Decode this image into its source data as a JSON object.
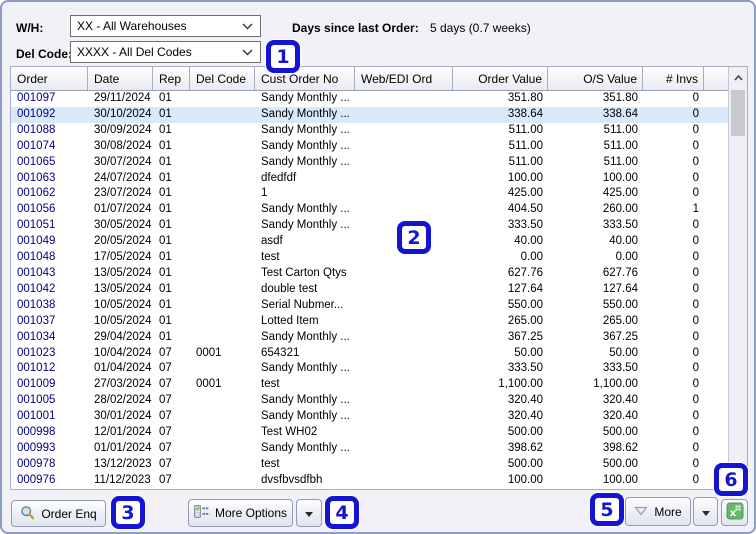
{
  "filters": {
    "wh_label": "W/H:",
    "wh_value": "XX - All Warehouses",
    "del_label": "Del Code:",
    "del_value": "XXXX - All Del Codes",
    "days_label": "Days since last Order:",
    "days_value": "5 days (0.7 weeks)"
  },
  "table": {
    "columns": [
      "Order",
      "Date",
      "Rep",
      "Del Code",
      "Cust Order No",
      "Web/EDI Ord",
      "Order Value",
      "O/S Value",
      "# Invs"
    ],
    "selected_order": "001092",
    "rows": [
      [
        "001097",
        "29/11/2024",
        "01",
        "",
        "Sandy Monthly ...",
        "",
        "351.80",
        "351.80",
        "0"
      ],
      [
        "001092",
        "30/10/2024",
        "01",
        "",
        "Sandy Monthly ...",
        "",
        "338.64",
        "338.64",
        "0"
      ],
      [
        "001088",
        "30/09/2024",
        "01",
        "",
        "Sandy Monthly ...",
        "",
        "511.00",
        "511.00",
        "0"
      ],
      [
        "001074",
        "30/08/2024",
        "01",
        "",
        "Sandy Monthly ...",
        "",
        "511.00",
        "511.00",
        "0"
      ],
      [
        "001065",
        "30/07/2024",
        "01",
        "",
        "Sandy Monthly ...",
        "",
        "511.00",
        "511.00",
        "0"
      ],
      [
        "001063",
        "24/07/2024",
        "01",
        "",
        "dfedfdf",
        "",
        "100.00",
        "100.00",
        "0"
      ],
      [
        "001062",
        "23/07/2024",
        "01",
        "",
        "1",
        "",
        "425.00",
        "425.00",
        "0"
      ],
      [
        "001056",
        "01/07/2024",
        "01",
        "",
        "Sandy Monthly ...",
        "",
        "404.50",
        "260.00",
        "1"
      ],
      [
        "001051",
        "30/05/2024",
        "01",
        "",
        "Sandy Monthly ...",
        "",
        "333.50",
        "333.50",
        "0"
      ],
      [
        "001049",
        "20/05/2024",
        "01",
        "",
        "asdf",
        "",
        "40.00",
        "40.00",
        "0"
      ],
      [
        "001048",
        "17/05/2024",
        "01",
        "",
        "test",
        "",
        "0.00",
        "0.00",
        "0"
      ],
      [
        "001043",
        "13/05/2024",
        "01",
        "",
        "Test Carton Qtys",
        "",
        "627.76",
        "627.76",
        "0"
      ],
      [
        "001042",
        "13/05/2024",
        "01",
        "",
        "double test",
        "",
        "127.64",
        "127.64",
        "0"
      ],
      [
        "001038",
        "10/05/2024",
        "01",
        "",
        "Serial Nubmer...",
        "",
        "550.00",
        "550.00",
        "0"
      ],
      [
        "001037",
        "10/05/2024",
        "01",
        "",
        "Lotted Item",
        "",
        "265.00",
        "265.00",
        "0"
      ],
      [
        "001034",
        "29/04/2024",
        "01",
        "",
        "Sandy Monthly ...",
        "",
        "367.25",
        "367.25",
        "0"
      ],
      [
        "001023",
        "10/04/2024",
        "07",
        "0001",
        "654321",
        "",
        "50.00",
        "50.00",
        "0"
      ],
      [
        "001012",
        "01/04/2024",
        "07",
        "",
        "Sandy Monthly ...",
        "",
        "333.50",
        "333.50",
        "0"
      ],
      [
        "001009",
        "27/03/2024",
        "07",
        "0001",
        "test",
        "",
        "1,100.00",
        "1,100.00",
        "0"
      ],
      [
        "001005",
        "28/02/2024",
        "07",
        "",
        "Sandy Monthly ...",
        "",
        "320.40",
        "320.40",
        "0"
      ],
      [
        "001001",
        "30/01/2024",
        "07",
        "",
        "Sandy Monthly ...",
        "",
        "320.40",
        "320.40",
        "0"
      ],
      [
        "000998",
        "12/01/2024",
        "07",
        "",
        "Test WH02",
        "",
        "500.00",
        "500.00",
        "0"
      ],
      [
        "000993",
        "01/01/2024",
        "07",
        "",
        "Sandy Monthly ...",
        "",
        "398.62",
        "398.62",
        "0"
      ],
      [
        "000978",
        "13/12/2023",
        "07",
        "",
        "test",
        "",
        "500.00",
        "500.00",
        "0"
      ],
      [
        "000976",
        "11/12/2023",
        "07",
        "",
        "dvsfbvsdfbh",
        "",
        "100.00",
        "100.00",
        "0"
      ]
    ]
  },
  "toolbar": {
    "order_enq_label": "Order Enq",
    "more_options_label": "More Options",
    "more_label": "More"
  },
  "icons": {
    "order_enq": "search-icon",
    "more_options": "form-options-icon",
    "more": "triangle-down-icon",
    "split_arrows": "dropdown-arrow-icon",
    "excel": "excel-export-icon"
  },
  "callouts": [
    "1",
    "2",
    "3",
    "4",
    "5",
    "6"
  ],
  "colors": {
    "callout_blue": "#1414d2",
    "selected_row": "#d8eaf9",
    "order_link_blue": "#000080",
    "excel_green": "#67b868",
    "window_border": "#8e9cc6",
    "window_bg": "#f2f1f8"
  }
}
